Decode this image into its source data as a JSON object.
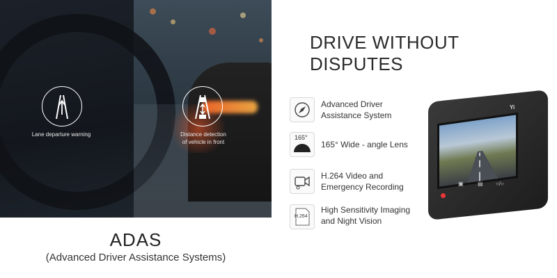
{
  "adas_panel": {
    "lane_badge_label": "Lane departure warning",
    "distance_badge_label_line1": "Distance detection",
    "distance_badge_label_line2": "of vehicle in front",
    "title": "ADAS",
    "subtitle": "(Advanced Driver Assistance Systems)"
  },
  "features_panel": {
    "headline": "DRIVE WITHOUT DISPUTES",
    "features": [
      {
        "icon": "compass-icon",
        "line1": "Advanced Driver",
        "line2": "Assistance System"
      },
      {
        "icon": "wide-angle-lens-icon",
        "icon_label": "165°",
        "line1": "165° Wide - angle Lens",
        "line2": ""
      },
      {
        "icon": "video-camera-icon",
        "line1": "H.264 Video and",
        "line2": "Emergency Recording"
      },
      {
        "icon": "h264-file-icon",
        "icon_label": "H.264",
        "line1": "High Sensitivity Imaging",
        "line2": "and Night Vision"
      }
    ]
  },
  "camera": {
    "brand": "Yi"
  },
  "colors": {
    "accent_red": "#e8363a",
    "text_dark": "#2a2a2a"
  }
}
